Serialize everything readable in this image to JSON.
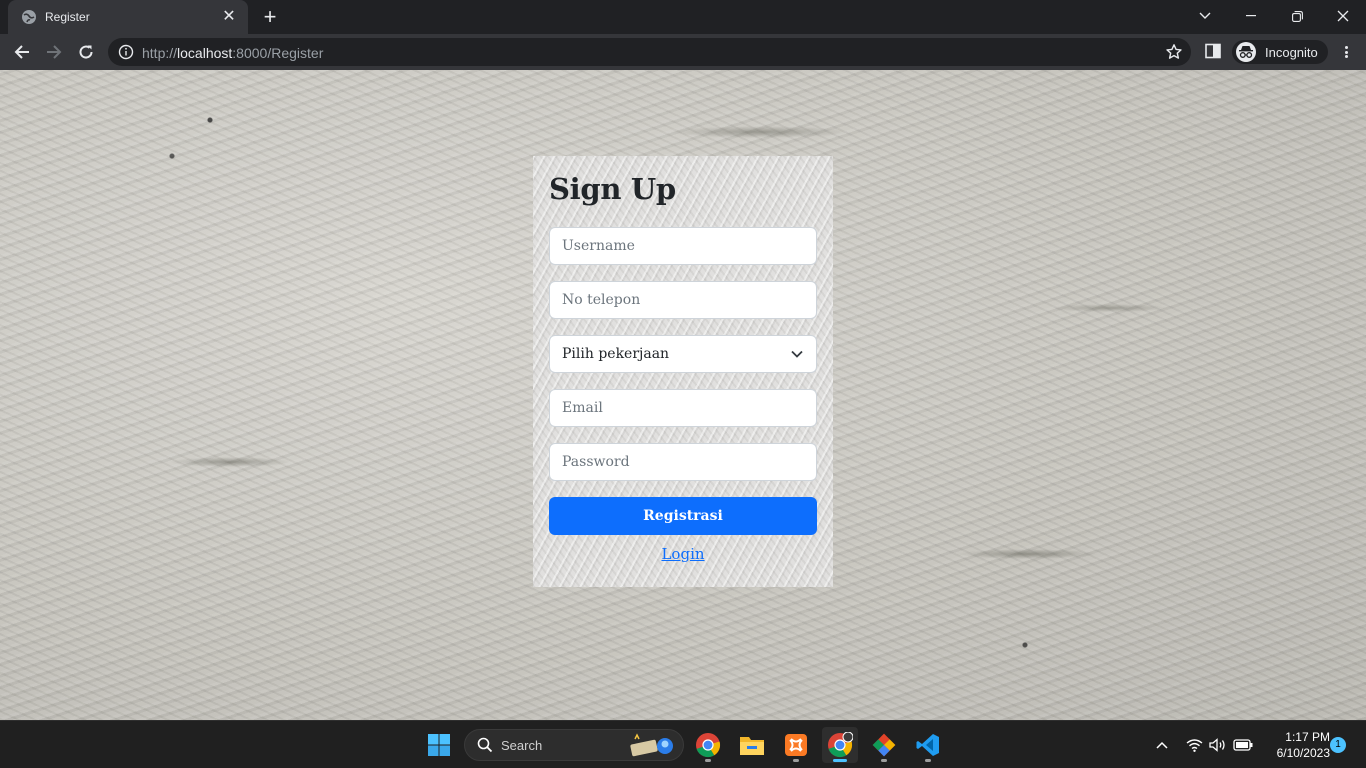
{
  "browser": {
    "tab_title": "Register",
    "new_tab_label": "+",
    "url_prefix": "http://",
    "url_host": "localhost",
    "url_rest": ":8000/Register",
    "profile_label": "Incognito"
  },
  "page": {
    "title": "Sign Up",
    "fields": {
      "username_placeholder": "Username",
      "phone_placeholder": "No telepon",
      "job_select_value": "Pilih pekerjaan",
      "email_placeholder": "Email",
      "password_placeholder": "Password"
    },
    "submit_label": "Registrasi",
    "login_link": "Login"
  },
  "taskbar": {
    "search_label": "Search",
    "time": "1:17 PM",
    "date": "6/10/2023",
    "notification_count": "1",
    "apps": [
      "start-icon",
      "chrome-icon",
      "file-explorer-icon",
      "xampp-icon",
      "chrome-active-icon",
      "git-icon",
      "vscode-icon"
    ]
  },
  "colors": {
    "primary": "#0d6efd",
    "browser_dark": "#202124",
    "toolbar": "#35363a",
    "taskbar": "#202020"
  }
}
